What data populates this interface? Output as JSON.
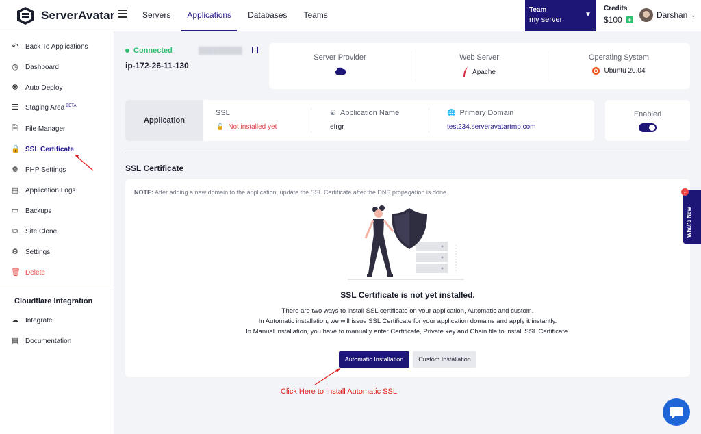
{
  "brand": {
    "name": "ServerAvatar"
  },
  "nav": {
    "items": [
      {
        "label": "Servers",
        "active": false
      },
      {
        "label": "Applications",
        "active": true
      },
      {
        "label": "Databases",
        "active": false
      },
      {
        "label": "Teams",
        "active": false
      }
    ]
  },
  "team": {
    "label": "Team",
    "value": "my server"
  },
  "credits": {
    "label": "Credits",
    "value": "$100"
  },
  "user": {
    "name": "Darshan"
  },
  "sidebar": {
    "items": [
      {
        "label": "Back To Applications",
        "icon": "arrow-left-circle-icon"
      },
      {
        "label": "Dashboard",
        "icon": "dashboard-icon"
      },
      {
        "label": "Auto Deploy",
        "icon": "auto-deploy-icon"
      },
      {
        "label": "Staging Area",
        "icon": "staging-icon",
        "badge": "BETA"
      },
      {
        "label": "File Manager",
        "icon": "file-icon"
      },
      {
        "label": "SSL Certificate",
        "icon": "lock-icon",
        "active": true
      },
      {
        "label": "PHP Settings",
        "icon": "php-icon"
      },
      {
        "label": "Application Logs",
        "icon": "logs-icon"
      },
      {
        "label": "Backups",
        "icon": "backup-icon"
      },
      {
        "label": "Site Clone",
        "icon": "clone-icon"
      },
      {
        "label": "Settings",
        "icon": "gear-icon"
      },
      {
        "label": "Delete",
        "icon": "trash-icon",
        "danger": true
      }
    ],
    "cloudflare_heading": "Cloudflare Integration",
    "cloudflare_items": [
      {
        "label": "Integrate",
        "icon": "cloud-icon"
      },
      {
        "label": "Documentation",
        "icon": "document-icon"
      }
    ]
  },
  "server": {
    "status": "Connected",
    "host": "ip-172-26-11-130"
  },
  "info": {
    "provider_label": "Server Provider",
    "webserver_label": "Web Server",
    "webserver_value": "Apache",
    "os_label": "Operating System",
    "os_value": "Ubuntu 20.04"
  },
  "application": {
    "tab": "Application",
    "ssl_label": "SSL",
    "ssl_value": "Not installed yet",
    "name_label": "Application Name",
    "name_value": "efrgr",
    "domain_label": "Primary Domain",
    "domain_value": "test234.serveravatartmp.com",
    "enabled_label": "Enabled",
    "enabled": true
  },
  "ssl": {
    "section_title": "SSL Certificate",
    "note_prefix": "NOTE:",
    "note": "After adding a new domain to the application, update the SSL Certificate after the DNS propagation is done.",
    "heading": "SSL Certificate is not yet installed.",
    "desc_line1": "There are two ways to install SSL certificate on your application, Automatic and custom.",
    "desc_line2": "In Automatic installation, we will issue SSL Certificate for your application domains and apply it instantly.",
    "desc_line3": "In Manual installation, you have to manually enter Certificate, Private key and Chain file to install SSL Certificate.",
    "auto_button": "Automatic Installation",
    "custom_button": "Custom Installation"
  },
  "annotation": {
    "text": "Click Here to Install Automatic SSL"
  },
  "whats_new": {
    "label": "What's New",
    "count": "1"
  },
  "colors": {
    "primary": "#1e1677",
    "success": "#2fbf71",
    "danger": "#e64545",
    "annotation": "#e02020"
  }
}
